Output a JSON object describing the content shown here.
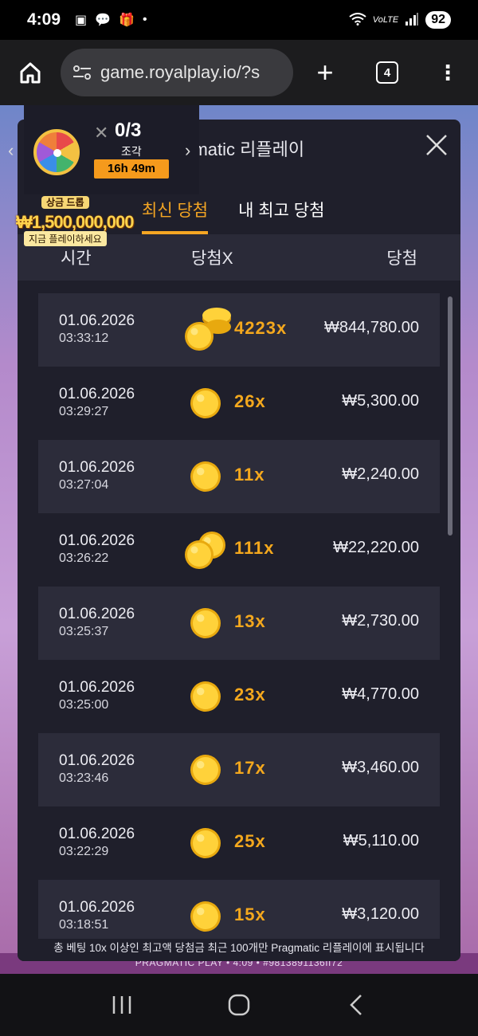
{
  "status": {
    "time": "4:09",
    "battery": "92",
    "network": "VoLTE"
  },
  "browser": {
    "url": "game.royalplay.io/?s",
    "tab_count": "4",
    "plus": "+",
    "menu": "⋮"
  },
  "promo": {
    "count": "0/3",
    "piece_label": "조각",
    "timer": "16h 49m",
    "jackpot_title": "상금 드롭",
    "jackpot_amount": "₩1,500,000,000",
    "cta": "지금 플레이하세요",
    "prev": "‹",
    "next": "›",
    "x": "✕"
  },
  "modal": {
    "title": "Pragmatic 리플레이",
    "tabs": [
      "최신 당첨",
      "내 최고 당첨"
    ],
    "columns": {
      "time": "시간",
      "mult": "당첨X",
      "win": "당첨"
    },
    "rows": [
      {
        "date": "01.06.2026",
        "time": "03:33:12",
        "mult": "4223x",
        "amount": "₩844,780.00",
        "coin": "stack"
      },
      {
        "date": "01.06.2026",
        "time": "03:29:27",
        "mult": "26x",
        "amount": "₩5,300.00",
        "coin": "single"
      },
      {
        "date": "01.06.2026",
        "time": "03:27:04",
        "mult": "11x",
        "amount": "₩2,240.00",
        "coin": "single"
      },
      {
        "date": "01.06.2026",
        "time": "03:26:22",
        "mult": "111x",
        "amount": "₩22,220.00",
        "coin": "double"
      },
      {
        "date": "01.06.2026",
        "time": "03:25:37",
        "mult": "13x",
        "amount": "₩2,730.00",
        "coin": "single"
      },
      {
        "date": "01.06.2026",
        "time": "03:25:00",
        "mult": "23x",
        "amount": "₩4,770.00",
        "coin": "single"
      },
      {
        "date": "01.06.2026",
        "time": "03:23:46",
        "mult": "17x",
        "amount": "₩3,460.00",
        "coin": "single"
      },
      {
        "date": "01.06.2026",
        "time": "03:22:29",
        "mult": "25x",
        "amount": "₩5,110.00",
        "coin": "single"
      },
      {
        "date": "01.06.2026",
        "time": "03:18:51",
        "mult": "15x",
        "amount": "₩3,120.00",
        "coin": "single"
      }
    ],
    "footer": "총 베팅 10x 이상인 최고액 당첨금 최근 100개만 Pragmatic 리플레이에 표시됩니다"
  },
  "game_footer": "PRAGMATIC PLAY • 4:09 • #9813891136II72",
  "colors": {
    "accent": "#f5a623",
    "modal_bg": "#1f1f2b",
    "row_alt": "#2c2c3a",
    "mult": "#f4a81d"
  }
}
